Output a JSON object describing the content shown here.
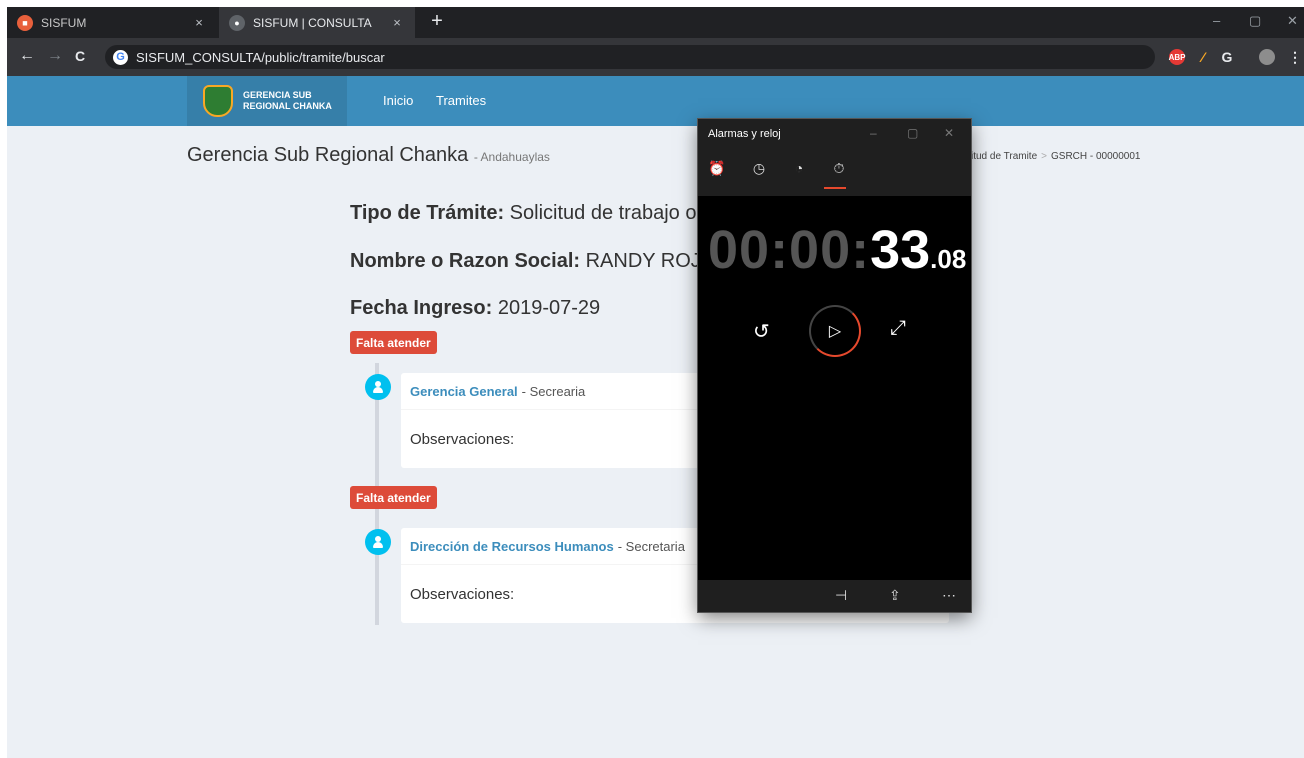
{
  "browser": {
    "tabs": [
      {
        "title": "SISFUM",
        "close": "×",
        "active": false
      },
      {
        "title": "SISFUM | CONSULTA",
        "close": "×",
        "active": true
      }
    ],
    "new_tab": "+",
    "url": "SISFUM_CONSULTA/public/tramite/buscar",
    "nav": {
      "back": "←",
      "forward": "→",
      "reload": "C"
    },
    "window_controls": {
      "minimize": "–",
      "maximize": "▢",
      "close": "✕"
    },
    "extensions": [
      {
        "name": "adblock-icon",
        "label": "ABP",
        "color": "#e53935"
      },
      {
        "name": "g-extension-icon",
        "label": "G",
        "color": "#5f6368"
      }
    ]
  },
  "site": {
    "logo_line1": "GERENCIA SUB",
    "logo_line2": "REGIONAL CHANKA",
    "nav_links": [
      "Inicio",
      "Tramites"
    ],
    "title": "Gerencia Sub Regional Chanka",
    "subtitle": "- Andahuaylas",
    "breadcrumb": {
      "current_partial": "itud de Tramite",
      "separator": ">",
      "code": "GSRCH - 00000001"
    }
  },
  "tramite": {
    "tipo_label": "Tipo de Trámite:",
    "tipo_value": "Solicitud de trabajo ope",
    "nombre_label": "Nombre o Razon Social:",
    "nombre_value": "RANDY ROJAS R",
    "fecha_label": "Fecha Ingreso:",
    "fecha_value": "2019-07-29"
  },
  "timeline": [
    {
      "status": "Falta atender",
      "office": "Gerencia General",
      "role": "- Secrearia",
      "obs_label": "Observaciones:"
    },
    {
      "status": "Falta atender",
      "office": "Dirección de Recursos Humanos",
      "role": "- Secretaria",
      "obs_label": "Observaciones:"
    }
  ],
  "clock_app": {
    "title": "Alarmas y reloj",
    "tab_icons": [
      "alarm-icon",
      "world-clock-icon",
      "timer-icon",
      "stopwatch-icon"
    ],
    "active_tab": "stopwatch-icon",
    "time_dim": "00:00:",
    "time_seconds": "33",
    "time_centis": ".08",
    "accent": "#e6492d"
  },
  "colors": {
    "navbar": "#3c8dbc",
    "logo_bg": "#367fa9",
    "label_red": "#dd4b39",
    "timeline_icon": "#00c0ef",
    "link": "#3c8dbc"
  }
}
